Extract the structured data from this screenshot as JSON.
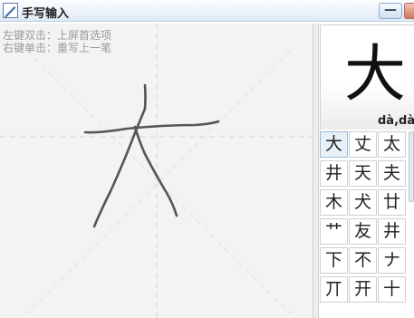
{
  "window": {
    "title": "手写输入",
    "minimize_label": "—"
  },
  "pad": {
    "hint_line1": "左键双击：上屏首选项",
    "hint_line2": "右键单击：重写上一笔"
  },
  "preview": {
    "char": "大",
    "pinyin": "dà,dài"
  },
  "candidates": [
    [
      "大",
      "丈",
      "太"
    ],
    [
      "井",
      "天",
      "夫"
    ],
    [
      "木",
      "犬",
      "廿"
    ],
    [
      "艹",
      "友",
      "井"
    ],
    [
      "下",
      "不",
      "ナ"
    ],
    [
      "丌",
      "开",
      "十"
    ]
  ],
  "selected_candidate": "大",
  "colors": {
    "stroke": "#555555",
    "guide": "#dadada",
    "title_gradient_top": "#fdfefe",
    "title_gradient_bottom": "#dfeaf6"
  },
  "icons": {
    "app": "pen-icon",
    "minimize": "minimize-icon",
    "close": "close-icon"
  }
}
